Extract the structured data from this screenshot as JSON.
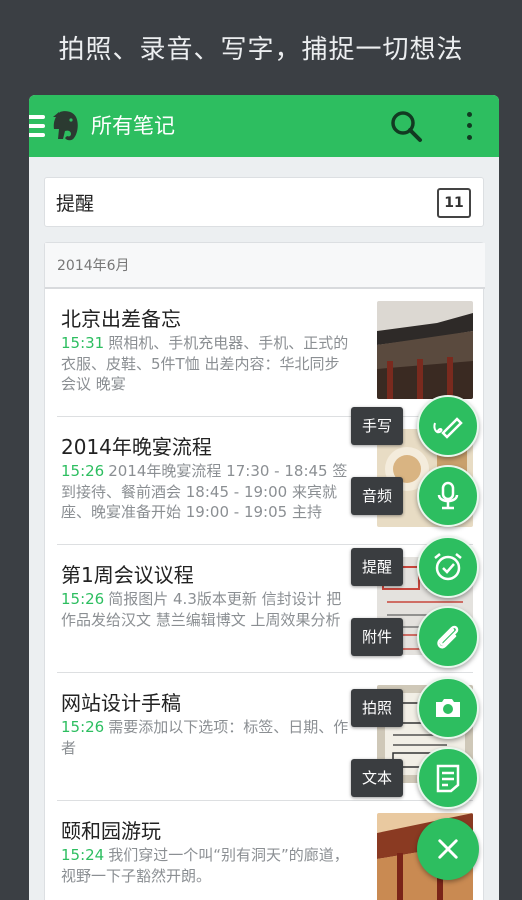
{
  "banner": {
    "text": "拍照、录音、写字，捕捉一切想法"
  },
  "appbar": {
    "title": "所有笔记",
    "menu_icon": "hamburger-icon",
    "logo_icon": "evernote-elephant-icon",
    "search_icon": "search-icon",
    "more_icon": "more-vert-icon",
    "color": "#2dbe60"
  },
  "reminder": {
    "label": "提醒",
    "count": "11"
  },
  "list": {
    "month": "2014年6月",
    "notes": [
      {
        "title": "北京出差备忘",
        "time": "15:31",
        "snippet": "照相机、手机充电器、手机、正式的衣服、皮鞋、5件T恤 出差内容：华北同步会议 晚宴",
        "thumb": "beijing-roof"
      },
      {
        "title": "2014年晚宴流程",
        "time": "15:26",
        "snippet": "2014年晚宴流程 17:30 - 18:45 签到接待、餐前酒会 18:45 - 19:00 来宾就座、晚宴准备开始 19:00 - 19:05 主持",
        "thumb": "dinner-table"
      },
      {
        "title": "第1周会议议程",
        "time": "15:26",
        "snippet": "简报图片 4.3版本更新 信封设计 把作品发给汉文 慧兰编辑博文 上周效果分析",
        "thumb": "whiteboard"
      },
      {
        "title": "网站设计手稿",
        "time": "15:26",
        "snippet": "需要添加以下选项：标签、日期、作者",
        "thumb": "sketch-paper"
      },
      {
        "title": "颐和园游玩",
        "time": "15:24",
        "snippet": "我们穿过一个叫“别有洞天”的廊道，视野一下子豁然开朗。",
        "thumb": "palace-corridor"
      }
    ]
  },
  "fab_menu": [
    {
      "label": "手写",
      "icon": "handwriting-icon"
    },
    {
      "label": "音频",
      "icon": "microphone-icon"
    },
    {
      "label": "提醒",
      "icon": "alarm-clock-icon"
    },
    {
      "label": "附件",
      "icon": "paperclip-icon"
    },
    {
      "label": "拍照",
      "icon": "camera-icon"
    },
    {
      "label": "文本",
      "icon": "text-note-icon"
    }
  ],
  "fab_close": {
    "icon": "close-icon"
  }
}
